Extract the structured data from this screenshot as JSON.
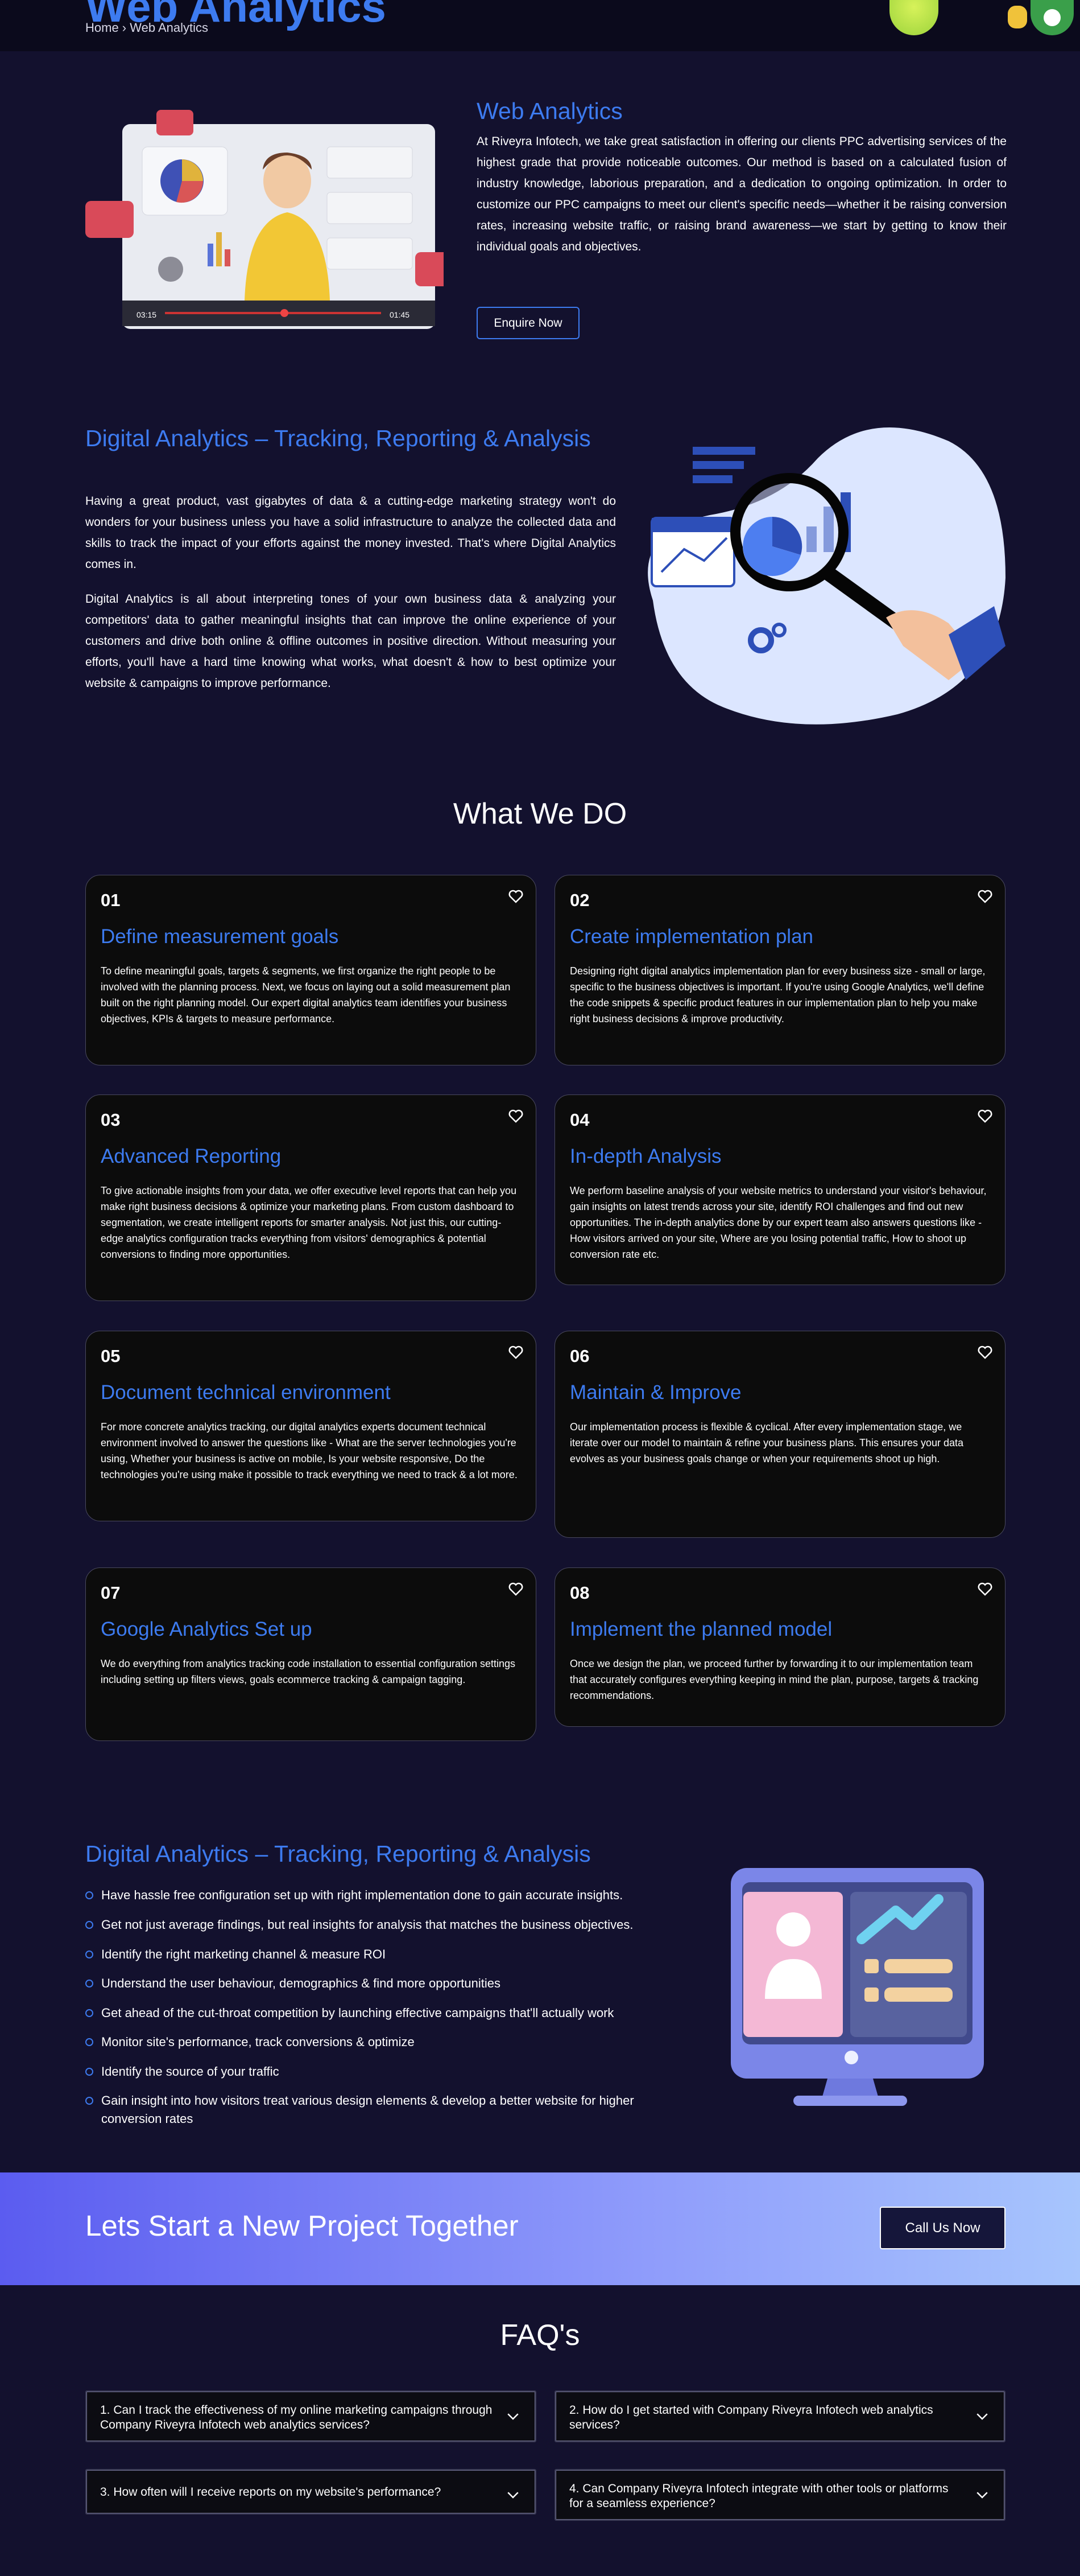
{
  "hero": {
    "title": "Web Analytics",
    "breadcrumb": "Home › Web Analytics"
  },
  "intro": {
    "heading": "Web Analytics",
    "text": "At Riveyra Infotech, we take great satisfaction in offering our clients PPC advertising services of the highest grade that provide noticeable outcomes. Our method is based on a calculated fusion of industry knowledge, laborious preparation, and a dedication to ongoing optimization. In order to customize our PPC campaigns to meet our client's specific needs—whether it be raising conversion rates, increasing website traffic, or raising brand awareness—we start by getting to know their individual goals and objectives.",
    "button": "Enquire Now",
    "video": {
      "time_start": "03:15",
      "time_end": "01:45"
    }
  },
  "tracking": {
    "heading": "Digital Analytics – Tracking, Reporting & Analysis",
    "para1": "Having a great product, vast gigabytes of data & a cutting-edge marketing strategy won't do wonders for your business unless you have a solid infrastructure to analyze the collected data and skills to track the impact of your efforts against the money invested. That's where Digital Analytics comes in.",
    "para2": "Digital Analytics is all about interpreting tones of your own business data & analyzing your competitors' data to gather meaningful insights that can improve the online experience of your customers and drive both online & offline outcomes in positive direction. Without measuring your efforts, you'll have a hard time knowing what works, what doesn't & how to best optimize your website & campaigns to improve performance."
  },
  "what_we_do": {
    "title": "What We DO",
    "cards": [
      {
        "num": "01",
        "title": "Define measurement goals",
        "text": "To define meaningful goals, targets & segments, we first organize the right people to be involved with the planning process. Next, we focus on laying out a solid measurement plan built on the right planning model. Our expert digital analytics team identifies your business objectives, KPIs & targets to measure performance."
      },
      {
        "num": "02",
        "title": "Create implementation plan",
        "text": "Designing right digital analytics implementation plan for every business size - small or large, specific to the business objectives is important. If you're using Google Analytics, we'll define the code snippets & specific product features in our implementation plan to help you make right business decisions & improve productivity."
      },
      {
        "num": "03",
        "title": "Advanced Reporting",
        "text": "To give actionable insights from your data, we offer executive level reports that can help you make right business decisions & optimize your marketing plans. From custom dashboard to segmentation, we create intelligent reports for smarter analysis. Not just this, our cutting-edge analytics configuration tracks everything from visitors' demographics & potential conversions to finding more opportunities."
      },
      {
        "num": "04",
        "title": "In-depth Analysis",
        "text": "We perform baseline analysis of your website metrics to understand your visitor's behaviour, gain insights on latest trends across your site, identify ROI challenges and find out new opportunities. The in-depth analytics done by our expert team also answers questions like - How visitors arrived on your site, Where are you losing potential traffic, How to shoot up conversion rate etc."
      },
      {
        "num": "05",
        "title": "Document technical environment",
        "text": "For more concrete analytics tracking, our digital analytics experts document technical environment involved to answer the questions like - What are the server technologies you're using, Whether your business is active on mobile, Is your website responsive, Do the technologies you're using make it possible to track everything we need to track & a lot more."
      },
      {
        "num": "06",
        "title": "Maintain & Improve",
        "text": "Our implementation process is flexible & cyclical. After every implementation stage, we iterate over our model to maintain & refine your business plans. This ensures your data evolves as your business goals change or when your requirements shoot up high."
      },
      {
        "num": "07",
        "title": "Google Analytics Set up",
        "text": "We do everything from analytics tracking code installation to essential configuration settings including setting up filters views, goals ecommerce tracking & campaign tagging."
      },
      {
        "num": "08",
        "title": "Implement the planned model",
        "text": "Once we design the plan, we proceed further by forwarding it to our implementation team that accurately configures everything keeping in mind the plan, purpose, targets & tracking recommendations."
      }
    ]
  },
  "benefits": {
    "heading": "Digital Analytics – Tracking, Reporting & Analysis",
    "items": [
      "Have hassle free configuration set up with right implementation done to gain accurate insights.",
      "Get not just average findings, but real insights for analysis that matches the business objectives.",
      "Identify the right marketing channel & measure ROI",
      "Understand the user behaviour, demographics & find more opportunities",
      "Get ahead of the cut-throat competition by launching effective campaigns that'll actually work",
      "Monitor site's performance, track conversions & optimize",
      "Identify the source of your traffic",
      "Gain insight into how visitors treat various design elements & develop a better website for higher conversion rates"
    ]
  },
  "cta": {
    "title": "Lets Start a New Project Together",
    "button": "Call Us Now"
  },
  "faq": {
    "title": "FAQ's",
    "items": [
      "1. Can I track the effectiveness of my online marketing campaigns through Company Riveyra Infotech web analytics services?",
      "2. How do I get started with Company Riveyra Infotech web analytics services?",
      "3. How often will I receive reports on my website's performance?",
      "4. Can Company Riveyra Infotech integrate with other tools or platforms for a seamless experience?"
    ]
  },
  "colors": {
    "background": "#13112e",
    "accent": "#3d7bf0",
    "card": "#0c0c0c",
    "cta_gradient_start": "#5b5cf0",
    "cta_gradient_end": "#a7c5fd"
  }
}
